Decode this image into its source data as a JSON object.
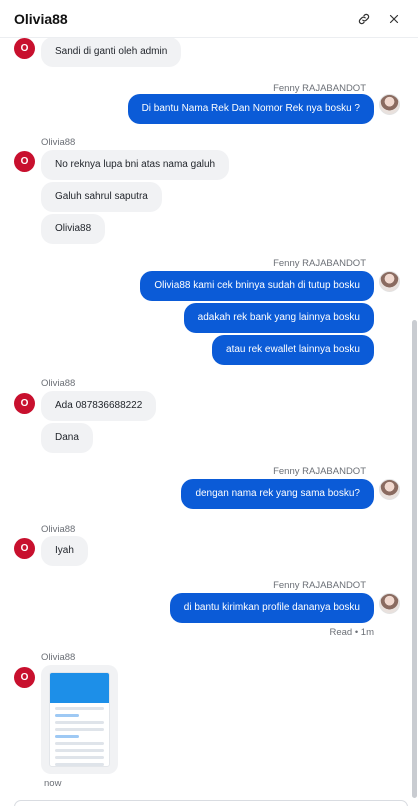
{
  "header": {
    "title": "Olivia88",
    "link_icon": "link-icon",
    "close_icon": "close-icon"
  },
  "messages": {
    "m1": {
      "text": "Sandi di ganti oleh admin"
    },
    "m2": {
      "sender": "Fenny RAJABANDOT",
      "text": "Di bantu Nama Rek Dan Nomor Rek nya bosku ?"
    },
    "m3": {
      "sender": "Olivia88",
      "texts": [
        "No reknya lupa bni atas nama galuh",
        "Galuh sahrul saputra",
        "Olivia88"
      ]
    },
    "m4": {
      "sender": "Fenny RAJABANDOT",
      "texts": [
        "Olivia88 kami cek bninya sudah di tutup bosku",
        "adakah rek bank yang lainnya bosku",
        "atau rek ewallet lainnya bosku"
      ]
    },
    "m5": {
      "sender": "Olivia88",
      "texts": [
        "Ada 087836688222",
        "Dana"
      ]
    },
    "m6": {
      "sender": "Fenny RAJABANDOT",
      "text": "dengan nama rek yang sama bosku?"
    },
    "m7": {
      "sender": "Olivia88",
      "text": "Iyah"
    },
    "m8": {
      "sender": "Fenny RAJABANDOT",
      "text": "di bantu kirimkan profile dananya bosku",
      "status": "Read • 1m"
    },
    "m9": {
      "sender": "Olivia88",
      "time": "now"
    }
  },
  "avatar_letter": "O",
  "colors": {
    "outgoing_bubble": "#0b5bd7",
    "incoming_bubble": "#f1f2f4",
    "avatar_red": "#c8102e"
  }
}
